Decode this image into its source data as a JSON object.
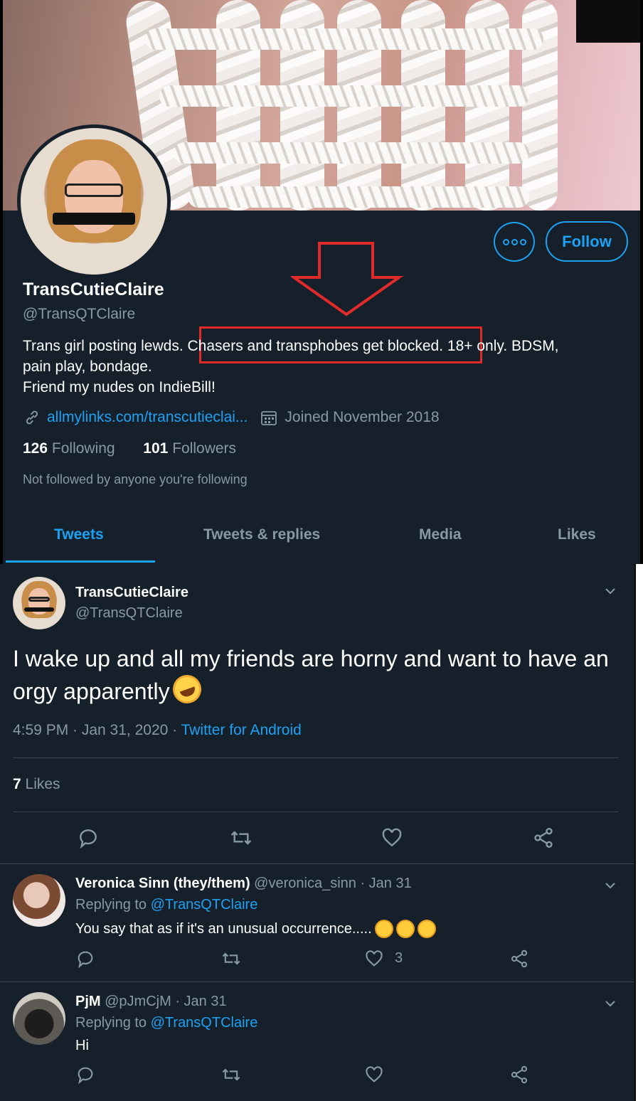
{
  "profile": {
    "display_name": "TransCutieClaire",
    "handle": "@TransQTClaire",
    "bio_line1_before": "Trans girl posting lewds.",
    "bio_line1_highlight": "Chasers and transphobes get blocked.",
    "bio_line1_after": "18+ only. BDSM,",
    "bio_line2": "pain play, bondage.",
    "bio_line3": "Friend my nudes on IndieBill!",
    "link": "allmylinks.com/transcutieclai...",
    "joined": "Joined November 2018",
    "following_count": "126",
    "following_label": "Following",
    "followers_count": "101",
    "followers_label": "Followers",
    "not_followed": "Not followed by anyone you're following",
    "follow_label": "Follow",
    "icons": [
      "more-icon",
      "link-icon",
      "calendar-icon"
    ]
  },
  "tabs": [
    {
      "label": "Tweets",
      "active": true
    },
    {
      "label": "Tweets & replies",
      "active": false
    },
    {
      "label": "Media",
      "active": false
    },
    {
      "label": "Likes",
      "active": false
    }
  ],
  "tweet": {
    "name": "TransCutieClaire",
    "handle": "@TransQTClaire",
    "text": "I wake up and all my friends are horny and want to have an orgy apparently",
    "time": "4:59 PM · Jan 31, 2020 · ",
    "source": "Twitter for Android",
    "likes_count": "7",
    "likes_label": "Likes"
  },
  "replies": [
    {
      "name": "Veronica Sinn (they/them)",
      "handle_date": "@veronica_sinn · Jan 31",
      "replying_to_label": "Replying to",
      "replying_to": "@TransQTClaire",
      "text": "You say that as if it's an unusual occurrence.....",
      "like_count": "3"
    },
    {
      "name": "PjM",
      "handle_date": "@pJmCjM · Jan 31",
      "replying_to_label": "Replying to",
      "replying_to": "@TransQTClaire",
      "text": "Hi",
      "like_count": ""
    }
  ],
  "colors": {
    "background": "#15202b",
    "accent": "#1da1f2",
    "secondary_text": "#8899a6",
    "annotation_red": "#e22a2a"
  }
}
